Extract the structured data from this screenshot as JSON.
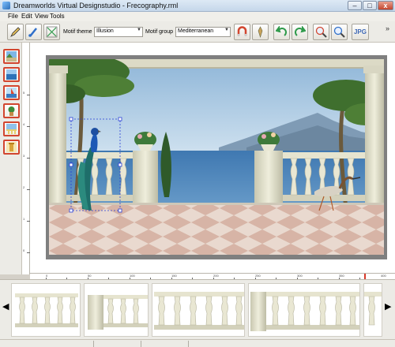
{
  "window": {
    "title": "Dreamworlds Virtual Designstudio - Frecography.rml",
    "min": "–",
    "max": "□",
    "close": "x"
  },
  "menu": [
    "File",
    "Edit",
    "View",
    "Tools"
  ],
  "toolbar": {
    "motif_theme_label": "Motif theme",
    "motif_theme_value": "Illusion",
    "motif_group_label": "Motif group",
    "motif_group_value": "Mediterranean",
    "jpg_label": "JPG",
    "more": "»"
  },
  "vruler": [
    "5",
    "4",
    "3",
    "2",
    "1",
    "0"
  ],
  "hruler": [
    "0",
    "50",
    "100",
    "150",
    "200",
    "250",
    "300",
    "350",
    "400"
  ],
  "strip": {
    "left_arrow": "◀",
    "right_arrow": "▶"
  },
  "colors": {
    "accent": "#d2462f",
    "selection": "#2a3fd6"
  }
}
